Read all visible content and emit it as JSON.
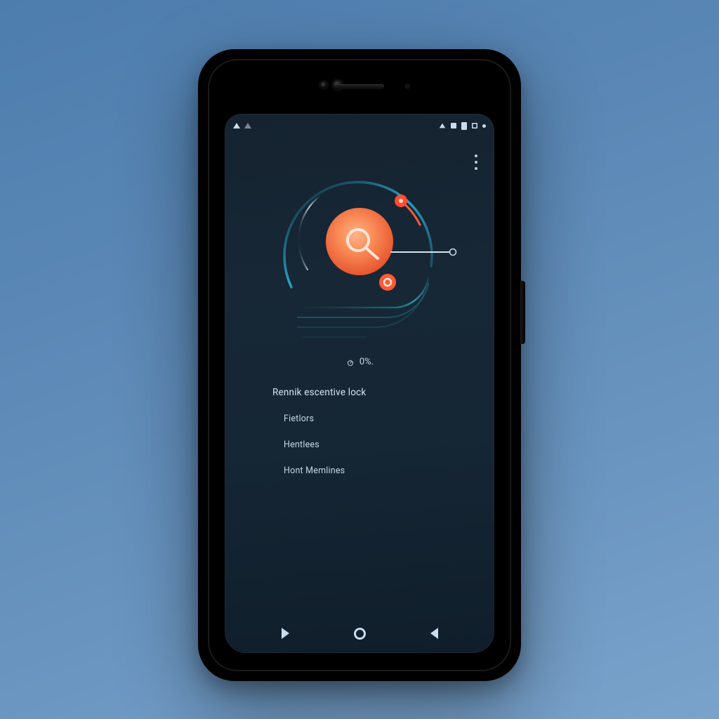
{
  "colors": {
    "accent": "#f36a3e",
    "accent_bright": "#ff5a3c",
    "arc_cyan": "#2aa2c4",
    "arc_teal": "#2b8fa1",
    "screen_bg": "#162634",
    "text": "#d7e4ef"
  },
  "statusbar": {
    "left_icons": [
      "signal-up-icon",
      "signal-up-outline-icon"
    ],
    "right_icons": [
      "signal-icon",
      "bar-icon",
      "bar-tall-icon",
      "bar-outline-icon",
      "dot-icon"
    ]
  },
  "appbar": {
    "overflow_label": "More options"
  },
  "meter": {
    "percent_label": "0%."
  },
  "menu": {
    "heading": "Rennik escentive lock",
    "items": [
      "Fietlors",
      "Hentlees",
      "Hont Memlines"
    ]
  },
  "navbar": {
    "recents_label": "Recents",
    "home_label": "Home",
    "back_label": "Back"
  }
}
